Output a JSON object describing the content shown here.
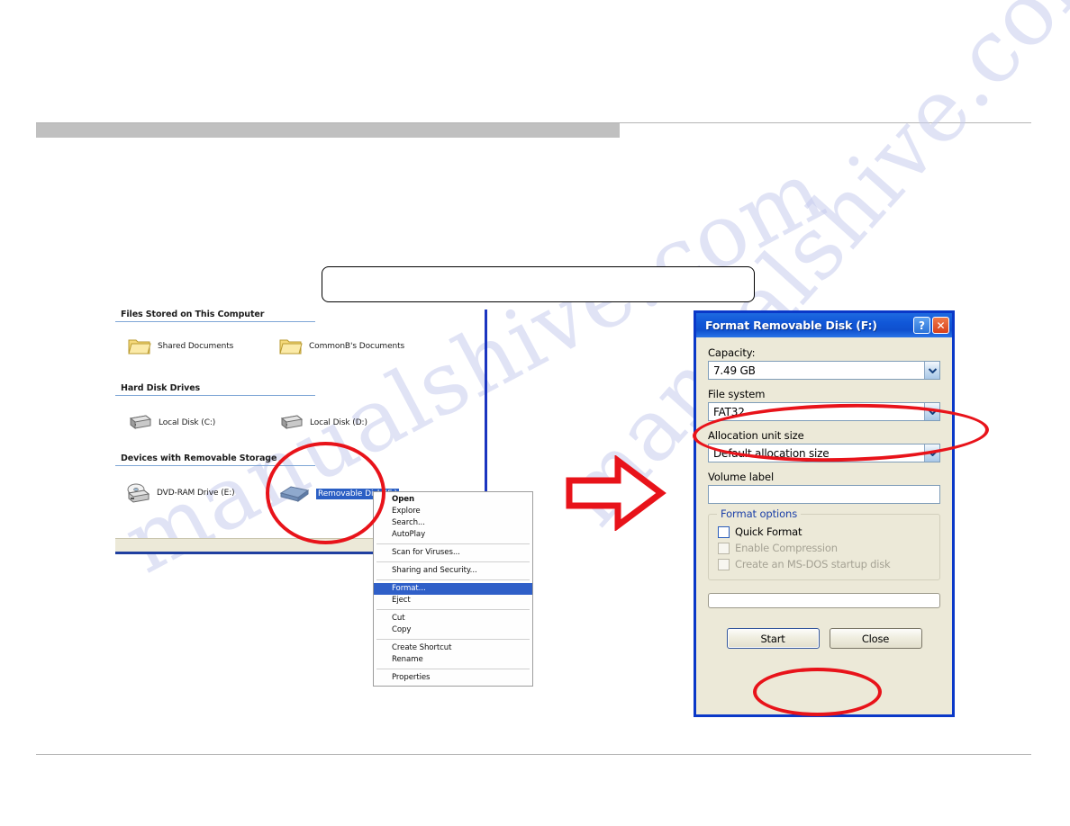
{
  "watermark": {
    "line1": "manualshive.com",
    "line2": "manualshive.com"
  },
  "explorer": {
    "sections": [
      {
        "title": "Files Stored on This Computer",
        "items": [
          {
            "label": "Shared Documents",
            "icon": "folder-icon",
            "selected": false
          },
          {
            "label": "CommonB's Documents",
            "icon": "folder-icon",
            "selected": false
          }
        ]
      },
      {
        "title": "Hard Disk Drives",
        "items": [
          {
            "label": "Local Disk (C:)",
            "icon": "hard-drive-icon",
            "selected": false
          },
          {
            "label": "Local Disk (D:)",
            "icon": "hard-drive-icon",
            "selected": false
          }
        ]
      },
      {
        "title": "Devices with Removable Storage",
        "items": [
          {
            "label": "DVD-RAM Drive (E:)",
            "icon": "optical-drive-icon",
            "selected": false
          },
          {
            "label": "Removable Disk (F:)",
            "icon": "removable-disk-icon",
            "selected": true
          }
        ]
      }
    ]
  },
  "context_menu": {
    "groups": [
      [
        {
          "label": "Open",
          "bold": true,
          "highlighted": false
        },
        {
          "label": "Explore",
          "bold": false,
          "highlighted": false
        },
        {
          "label": "Search...",
          "bold": false,
          "highlighted": false
        },
        {
          "label": "AutoPlay",
          "bold": false,
          "highlighted": false
        }
      ],
      [
        {
          "label": "Scan for Viruses...",
          "bold": false,
          "highlighted": false
        }
      ],
      [
        {
          "label": "Sharing and Security...",
          "bold": false,
          "highlighted": false
        }
      ],
      [
        {
          "label": "Format...",
          "bold": false,
          "highlighted": true
        },
        {
          "label": "Eject",
          "bold": false,
          "highlighted": false
        }
      ],
      [
        {
          "label": "Cut",
          "bold": false,
          "highlighted": false
        },
        {
          "label": "Copy",
          "bold": false,
          "highlighted": false
        }
      ],
      [
        {
          "label": "Create Shortcut",
          "bold": false,
          "highlighted": false
        },
        {
          "label": "Rename",
          "bold": false,
          "highlighted": false
        }
      ],
      [
        {
          "label": "Properties",
          "bold": false,
          "highlighted": false
        }
      ]
    ]
  },
  "format_dialog": {
    "title": "Format Removable Disk (F:)",
    "help_button": "?",
    "close_button": "✕",
    "capacity": {
      "label": "Capacity:",
      "value": "7.49 GB"
    },
    "file_system": {
      "label": "File system",
      "value": "FAT32"
    },
    "allocation_unit": {
      "label": "Allocation unit size",
      "value": "Default allocation size"
    },
    "volume_label": {
      "label": "Volume label",
      "value": ""
    },
    "format_options": {
      "legend": "Format options",
      "checkboxes": [
        {
          "label": "Quick Format",
          "checked": false,
          "disabled": false
        },
        {
          "label": "Enable Compression",
          "checked": false,
          "disabled": true
        },
        {
          "label": "Create an MS-DOS startup disk",
          "checked": false,
          "disabled": true
        }
      ]
    },
    "buttons": {
      "start": "Start",
      "close": "Close"
    }
  },
  "annotations": {
    "arrow": "right-arrow-annotation",
    "ellipses": [
      "removable-disk-highlight",
      "file-system-highlight",
      "start-button-highlight"
    ]
  },
  "colors": {
    "annotation_red": "#e8131a",
    "titlebar_blue": "#0f50ce",
    "selection_blue": "#2b5fc4",
    "menu_highlight": "#2f5fc8",
    "gray_bar": "#c0c0c0",
    "status_bar": "#ece9d8"
  }
}
